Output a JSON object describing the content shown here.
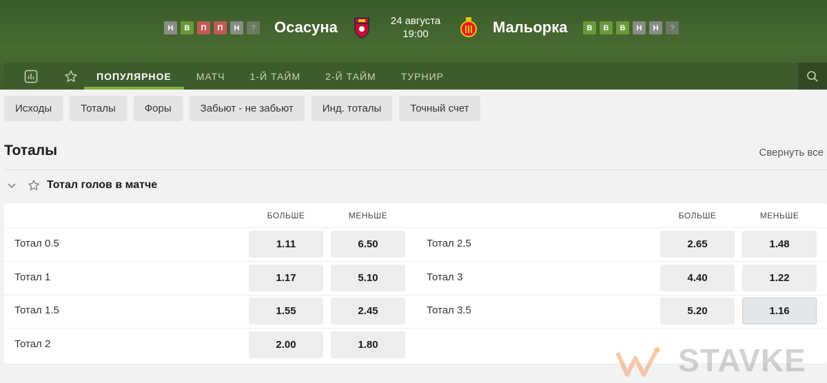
{
  "match": {
    "home": {
      "name": "Осасуна",
      "form": [
        "Н",
        "В",
        "П",
        "П",
        "Н",
        "?"
      ]
    },
    "away": {
      "name": "Мальорка",
      "form": [
        "В",
        "В",
        "В",
        "Н",
        "Н",
        "?"
      ]
    },
    "date": "24 августа",
    "time": "19:00"
  },
  "nav": {
    "tabs": [
      "ПОПУЛЯРНОЕ",
      "МАТЧ",
      "1-Й ТАЙМ",
      "2-Й ТАЙМ",
      "ТУРНИР"
    ],
    "active_tab": "ПОПУЛЯРНОЕ"
  },
  "filters": [
    "Исходы",
    "Тоталы",
    "Форы",
    "Забьют - не забьют",
    "Инд. тоталы",
    "Точный счет"
  ],
  "section": {
    "title": "Тоталы",
    "collapse_label": "Свернуть все"
  },
  "market": {
    "title": "Тотал голов в матче",
    "over_label": "БОЛЬШЕ",
    "under_label": "МЕНЬШЕ",
    "left_rows": [
      {
        "label": "Тотал 0.5",
        "over": "1.11",
        "under": "6.50"
      },
      {
        "label": "Тотал 1",
        "over": "1.17",
        "under": "5.10"
      },
      {
        "label": "Тотал 1.5",
        "over": "1.55",
        "under": "2.45"
      },
      {
        "label": "Тотал 2",
        "over": "2.00",
        "under": "1.80"
      }
    ],
    "right_rows": [
      {
        "label": "Тотал 2.5",
        "over": "2.65",
        "under": "1.48"
      },
      {
        "label": "Тотал 3",
        "over": "4.40",
        "under": "1.22"
      },
      {
        "label": "Тотал 3.5",
        "over": "5.20",
        "under": "1.16"
      }
    ]
  },
  "watermark": "STAVKE",
  "colors": {
    "header_green": "#486b31",
    "win": "#6a9a3a",
    "draw": "#888d86",
    "loss": "#c25a55",
    "active_underline": "#7fb23f"
  }
}
